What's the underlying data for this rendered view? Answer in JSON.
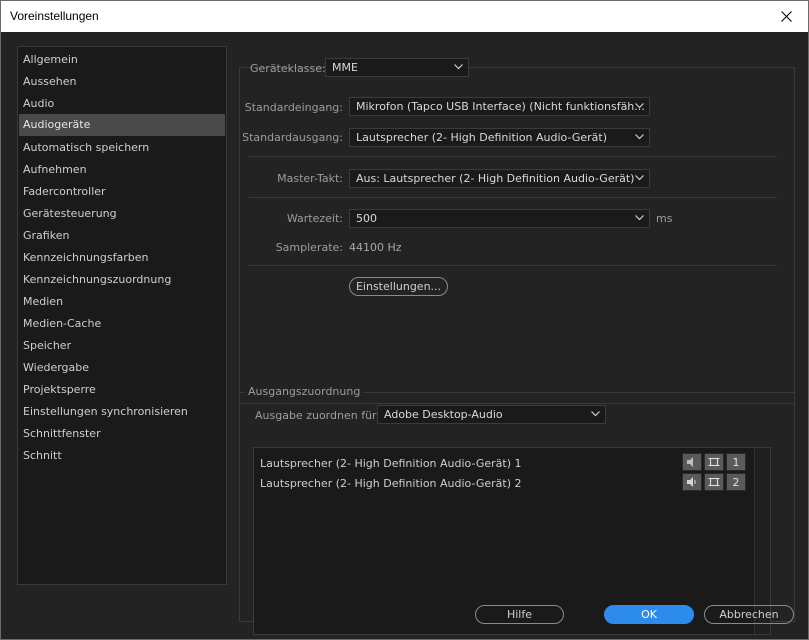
{
  "window": {
    "title": "Voreinstellungen",
    "close_icon": "close-icon"
  },
  "sidebar": {
    "selected_index": 3,
    "items": [
      {
        "label": "Allgemein"
      },
      {
        "label": "Aussehen"
      },
      {
        "label": "Audio"
      },
      {
        "label": "Audiogeräte"
      },
      {
        "label": "Automatisch speichern"
      },
      {
        "label": "Aufnehmen"
      },
      {
        "label": "Fadercontroller"
      },
      {
        "label": "Gerätesteuerung"
      },
      {
        "label": "Grafiken"
      },
      {
        "label": "Kennzeichnungsfarben"
      },
      {
        "label": "Kennzeichnungszuordnung"
      },
      {
        "label": "Medien"
      },
      {
        "label": "Medien-Cache"
      },
      {
        "label": "Speicher"
      },
      {
        "label": "Wiedergabe"
      },
      {
        "label": "Projektsperre"
      },
      {
        "label": "Einstellungen synchronisieren"
      },
      {
        "label": "Schnittfenster"
      },
      {
        "label": "Schnitt"
      }
    ]
  },
  "device": {
    "class_label": "Geräteklasse:",
    "class_value": "MME",
    "input_label": "Standardeingang:",
    "input_value": "Mikrofon (Tapco USB Interface) (Nicht funktionsfäh...",
    "output_label": "Standardausgang:",
    "output_value": "Lautsprecher (2- High Definition Audio-Gerät)",
    "master_label": "Master-Takt:",
    "master_value": "Aus: Lautsprecher (2- High Definition Audio-Gerät)",
    "wait_label": "Wartezeit:",
    "wait_value": "500",
    "wait_unit": "ms",
    "samplerate_label": "Samplerate:",
    "samplerate_value": "44100 Hz",
    "settings_button": "Einstellungen..."
  },
  "output_mapping": {
    "section_title": "Ausgangszuordnung",
    "map_for_label": "Ausgabe zuordnen für:",
    "map_for_value": "Adobe Desktop-Audio",
    "channels": [
      {
        "label": "Lautsprecher (2- High Definition Audio-Gerät) 1",
        "number": "1"
      },
      {
        "label": "Lautsprecher (2- High Definition Audio-Gerät) 2",
        "number": "2"
      }
    ]
  },
  "footer": {
    "help": "Hilfe",
    "ok": "OK",
    "cancel": "Abbrechen"
  },
  "colors": {
    "background": "#232323",
    "panel": "#1a1a1a",
    "accent": "#2d8ceb",
    "selection": "#4a4a4a"
  }
}
